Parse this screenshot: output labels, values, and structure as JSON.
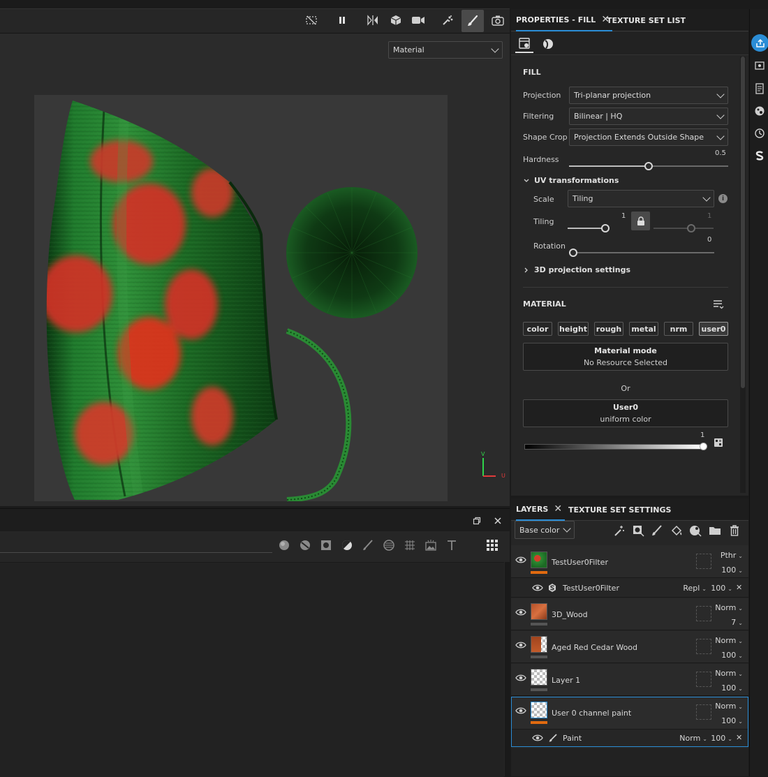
{
  "viewport": {
    "display_mode": "Material",
    "axis_labels": {
      "v": "V",
      "u": "U"
    }
  },
  "properties_panel": {
    "tab_active": "PROPERTIES - FILL",
    "tab_other": "TEXTURE SET LIST",
    "fill_section": "FILL",
    "projection_label": "Projection",
    "projection_value": "Tri-planar projection",
    "filtering_label": "Filtering",
    "filtering_value": "Bilinear | HQ",
    "shape_crop_label": "Shape Crop",
    "shape_crop_value": "Projection Extends Outside Shape",
    "hardness_label": "Hardness",
    "hardness_value": "0.5",
    "hardness_fraction": 0.5,
    "uv_section": "UV transformations",
    "scale_label": "Scale",
    "scale_value": "Tiling",
    "tiling_label": "Tiling",
    "tiling_value_1": "1",
    "tiling_value_2": "1",
    "rotation_label": "Rotation",
    "rotation_value": "0",
    "projection_settings": "3D projection settings",
    "material_section": "MATERIAL",
    "channels": [
      "color",
      "height",
      "rough",
      "metal",
      "nrm",
      "user0"
    ],
    "material_mode_title": "Material mode",
    "material_mode_sub": "No Resource Selected",
    "or_text": "Or",
    "user0_title": "User0",
    "user0_sub": "uniform color",
    "gradient_value": "1"
  },
  "layers_panel": {
    "tab_active": "LAYERS",
    "tab_other": "TEXTURE SET SETTINGS",
    "channel_select": "Base color",
    "layers": [
      {
        "name": "TestUser0Filter",
        "blend": "Pthr",
        "opacity": "100",
        "color_bar": "#e06a10"
      },
      {
        "name": "TestUser0Filter",
        "blend": "Repl",
        "opacity": "100",
        "sub": true
      },
      {
        "name": "3D_Wood",
        "blend": "Norm",
        "opacity": "7",
        "color_bar": "#555555"
      },
      {
        "name": "Aged Red Cedar Wood",
        "blend": "Norm",
        "opacity": "100",
        "color_bar": "#555555"
      },
      {
        "name": "Layer 1",
        "blend": "Norm",
        "opacity": "100",
        "color_bar": "#555555"
      },
      {
        "name": "User 0 channel paint",
        "blend": "Norm",
        "opacity": "100",
        "color_bar": "#e06a10"
      },
      {
        "name": "Paint",
        "blend": "Norm",
        "opacity": "100",
        "sub": true
      }
    ]
  },
  "colors": {
    "accent": "#2b8dd6",
    "orange": "#e06a10"
  }
}
